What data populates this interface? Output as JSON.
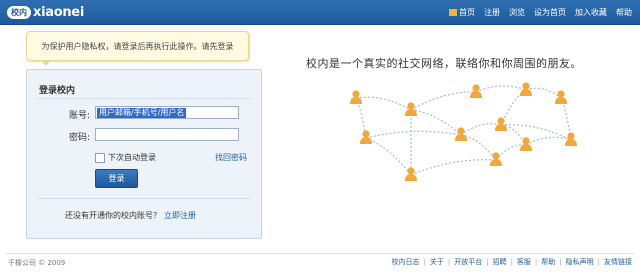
{
  "header": {
    "logo_badge": "校内",
    "logo_text": "xiaonei",
    "nav": [
      "首页",
      "注册",
      "浏览",
      "设为首页",
      "加入收藏",
      "帮助"
    ]
  },
  "notice": {
    "text": "为保护用户隐私权，请登录后再执行此操作。请先登录"
  },
  "login": {
    "title": "登录校内",
    "account_label": "账号:",
    "account_value": "用户邮箱/手机号/用户名",
    "password_label": "密码:",
    "remember_label": "下次自动登录",
    "forgot_label": "找回密码",
    "submit_label": "登录",
    "register_question": "还没有开通你的校内账号？",
    "register_link": "立即注册"
  },
  "promo": {
    "slogan": "校内是一个真实的社交网络，联络你和你周围的朋友。"
  },
  "footer": {
    "copyright": "千橡公司 © 2009",
    "links": [
      "校内日志",
      "关于",
      "开放平台",
      "招聘",
      "客服",
      "帮助",
      "隐私声明",
      "友情链接"
    ]
  },
  "colors": {
    "brand": "#1f5fa3",
    "person": "#f3a73a",
    "link_line": "#aab9cf"
  }
}
